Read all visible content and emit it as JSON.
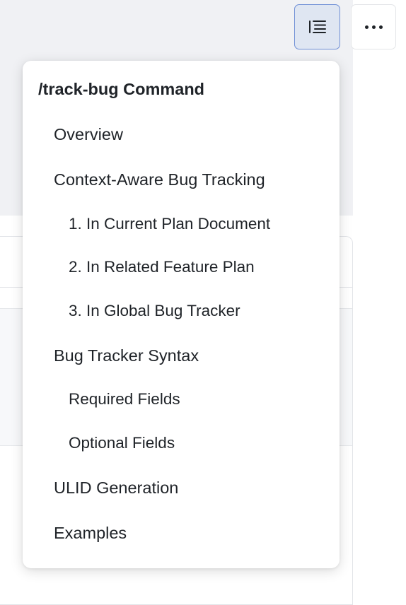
{
  "toolbar": {
    "toc_icon": "table-of-contents-icon",
    "more_icon": "more-horizontal-icon"
  },
  "toc": {
    "title": "/track-bug Command",
    "items": [
      {
        "label": "Overview",
        "level": 1
      },
      {
        "label": "Context-Aware Bug Tracking",
        "level": 1
      },
      {
        "label": "1. In Current Plan Document",
        "level": 2
      },
      {
        "label": "2. In Related Feature Plan",
        "level": 2
      },
      {
        "label": "3. In Global Bug Tracker",
        "level": 2
      },
      {
        "label": "Bug Tracker Syntax",
        "level": 1
      },
      {
        "label": "Required Fields",
        "level": 2
      },
      {
        "label": "Optional Fields",
        "level": 2
      },
      {
        "label": "ULID Generation",
        "level": 1
      },
      {
        "label": "Examples",
        "level": 1
      }
    ]
  },
  "colors": {
    "accent_border": "#6f8fd6",
    "accent_fill": "#dfe6f2",
    "text": "#1f2328"
  }
}
